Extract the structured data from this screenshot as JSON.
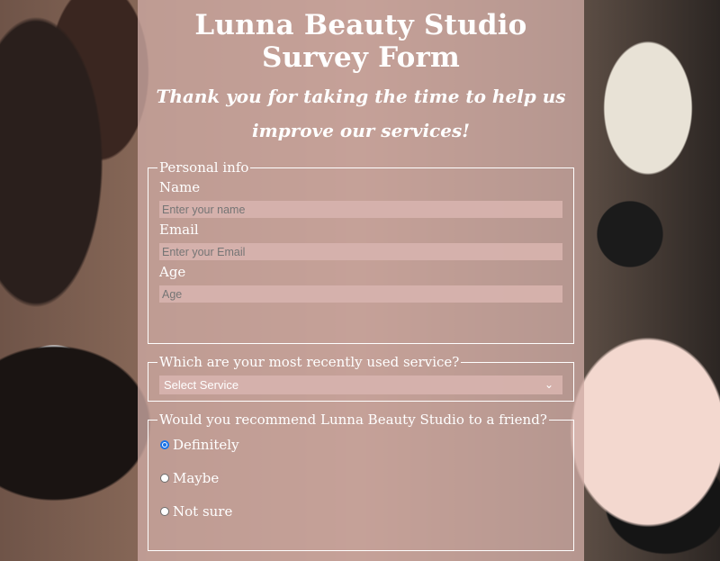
{
  "form": {
    "title": "Lunna Beauty Studio Survey Form",
    "subtitle": "Thank you for taking the time to help us improve our services!"
  },
  "personal_info": {
    "legend": "Personal info",
    "name_label": "Name",
    "name_placeholder": "Enter your name",
    "email_label": "Email",
    "email_placeholder": "Enter your Email",
    "age_label": "Age",
    "age_placeholder": "Age"
  },
  "service": {
    "legend": "Which are your most recently used service?",
    "selected": "Select Service"
  },
  "recommend": {
    "legend": "Would you recommend Lunna Beauty Studio to a friend?",
    "options": [
      {
        "label": "Definitely",
        "checked": true
      },
      {
        "label": "Maybe",
        "checked": false
      },
      {
        "label": "Not sure",
        "checked": false
      }
    ]
  },
  "colors": {
    "panel": "#CEAAA4",
    "radio_selected": "#1A73E8"
  }
}
